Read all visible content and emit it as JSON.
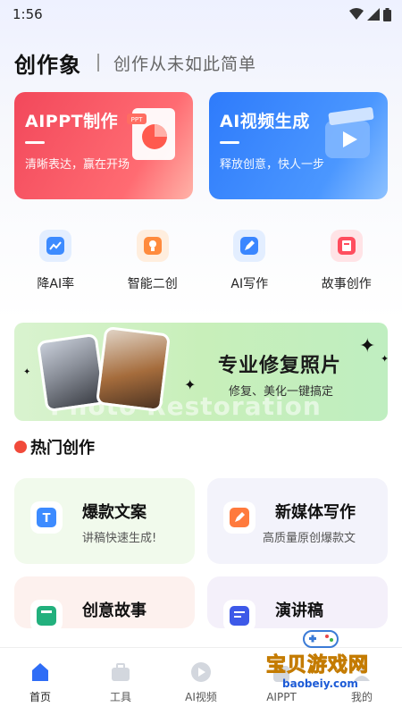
{
  "status": {
    "time": "1:56"
  },
  "header": {
    "brand": "创作象",
    "slogan": "创作从未如此简单"
  },
  "hero": [
    {
      "title": "AIPPT制作",
      "subtitle": "清晰表达，赢在开场",
      "ppt_tag": "PPT"
    },
    {
      "title": "AI视频生成",
      "subtitle": "释放创意，快人一步"
    }
  ],
  "quick": [
    {
      "label": "降AI率",
      "icon": "chart-icon"
    },
    {
      "label": "智能二创",
      "icon": "bulb-icon"
    },
    {
      "label": "AI写作",
      "icon": "pen-icon"
    },
    {
      "label": "故事创作",
      "icon": "book-icon"
    }
  ],
  "banner": {
    "title": "专业修复照片",
    "subtitle": "修复、美化一键搞定",
    "watermark": "Photo Restoration"
  },
  "section": {
    "title": "热门创作",
    "badge": "HOT"
  },
  "features": [
    {
      "title": "爆款文案",
      "subtitle": "讲稿快速生成!",
      "icon": "text-icon",
      "icon_letter": "T"
    },
    {
      "title": "新媒体写作",
      "subtitle": "高质量原创爆款文",
      "icon": "edit-icon"
    },
    {
      "title": "创意故事",
      "subtitle": "",
      "icon": "book-icon"
    },
    {
      "title": "演讲稿",
      "subtitle": "",
      "icon": "doc-icon"
    }
  ],
  "tabs": [
    {
      "label": "首页",
      "active": true
    },
    {
      "label": "工具",
      "active": false
    },
    {
      "label": "AI视频",
      "active": false
    },
    {
      "label": "AIPPT",
      "active": false
    },
    {
      "label": "我的",
      "active": false
    }
  ],
  "watermark": {
    "text": "宝贝游戏网",
    "url": "baobeiy.com"
  },
  "colors": {
    "accent_red": "#f2485b",
    "accent_blue": "#2e7bfb",
    "banner_green": "#c8efba"
  }
}
